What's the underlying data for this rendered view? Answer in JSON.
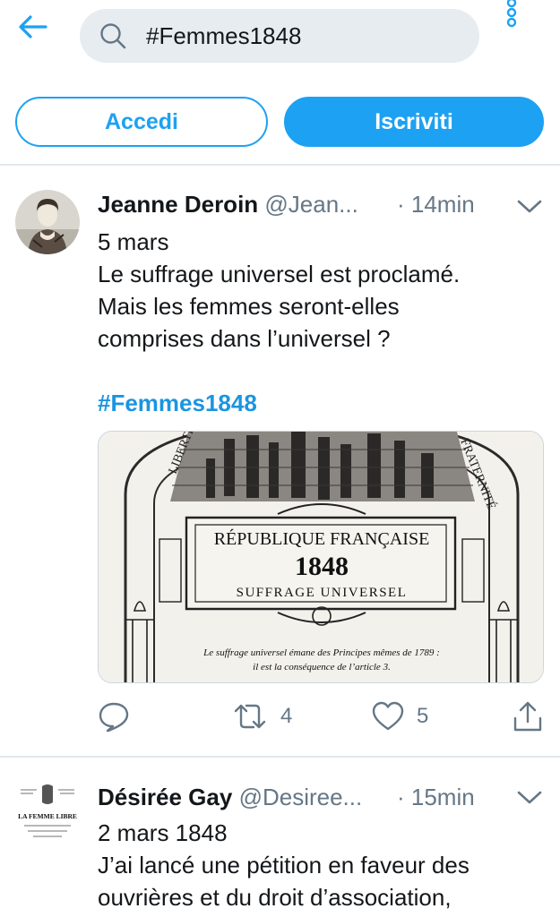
{
  "search": {
    "query": "#Femmes1848"
  },
  "auth": {
    "login_label": "Accedi",
    "signup_label": "Iscriviti"
  },
  "colors": {
    "accent": "#1da1f2",
    "secondary_text": "#657786",
    "divider": "#e1e8ed",
    "search_bg": "#e6ecf0"
  },
  "icons": {
    "back": "back-arrow-icon",
    "search": "search-icon",
    "more": "more-vertical-icon",
    "caret": "chevron-down-icon",
    "reply": "reply-icon",
    "retweet": "retweet-icon",
    "like": "heart-icon",
    "share": "share-icon"
  },
  "tweets": [
    {
      "display_name": "Jeanne Deroin",
      "handle": "@Jean...",
      "time": "· 14min",
      "lines": [
        "5 mars",
        "Le suffrage universel est proclamé.",
        "Mais les femmes seront-elles",
        "comprises dans l’universel ?"
      ],
      "hashtag": "#Femmes1848",
      "media": {
        "banner_left": "LIBERTÉ",
        "banner_right": "FRATERNITÉ",
        "heading": "RÉPUBLIQUE FRANÇAISE",
        "year": "1848",
        "subheading": "SUFFRAGE UNIVERSEL",
        "caption_line1": "Le suffrage universel émane des Principes mêmes de 1789 :",
        "caption_line2": "il est la conséquence de l’article 3."
      },
      "retweets": "4",
      "likes": "5"
    },
    {
      "display_name": "Désirée Gay",
      "handle": "@Desiree...",
      "time": "· 15min",
      "lines": [
        "2 mars 1848",
        "J’ai lancé une pétition en faveur des",
        "ouvrières et du droit d’association,"
      ],
      "avatar_text": "LA FEMME LIBRE"
    }
  ]
}
